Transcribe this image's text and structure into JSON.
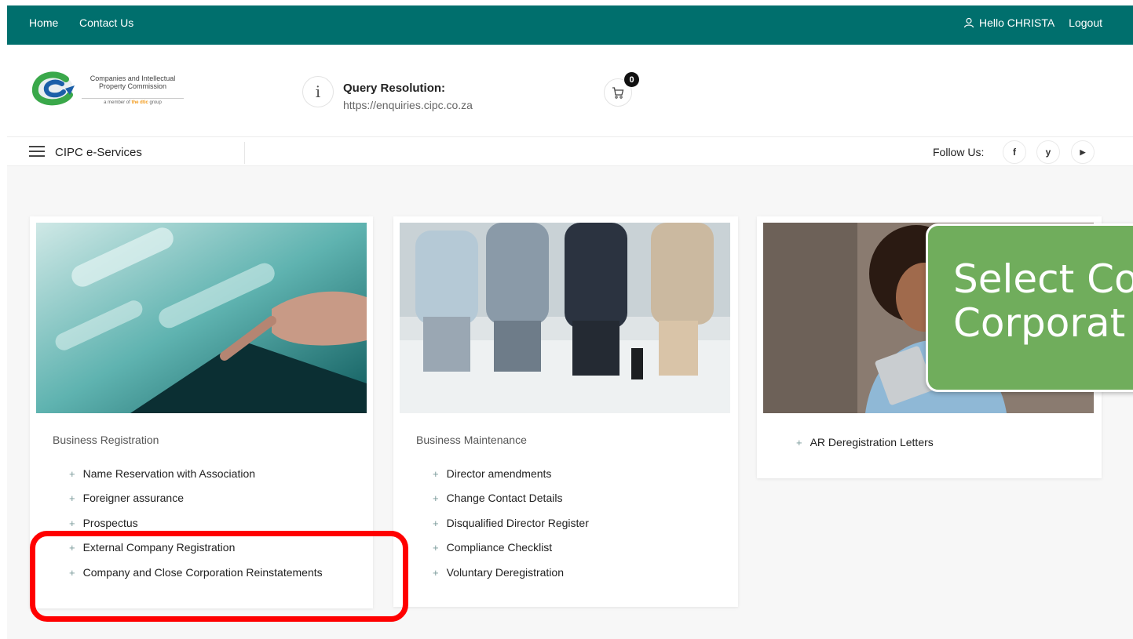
{
  "topbar": {
    "nav": [
      "Home",
      "Contact Us"
    ],
    "greeting": "Hello CHRISTA",
    "logout": "Logout"
  },
  "header": {
    "logo_line1": "Companies and Intellectual",
    "logo_line2": "Property Commission",
    "logo_sub_pre": "a member of",
    "logo_sub_brand": "the dtic",
    "logo_sub_post": "group",
    "query_title": "Query Resolution:",
    "query_url": "https://enquiries.cipc.co.za",
    "cart_count": "0"
  },
  "navbar": {
    "title": "CIPC e-Services",
    "follow_label": "Follow Us:",
    "social": [
      {
        "icon": "facebook-icon",
        "glyph": "f"
      },
      {
        "icon": "twitter-icon",
        "glyph": "y"
      },
      {
        "icon": "youtube-icon",
        "glyph": "▶"
      }
    ]
  },
  "cards": [
    {
      "title": "Business Registration",
      "items": [
        "Name Reservation with Association",
        "Foreigner assurance",
        "Prospectus",
        "External Company Registration",
        "Company and Close Corporation Reinstatements"
      ]
    },
    {
      "title": "Business Maintenance",
      "items": [
        "Director amendments",
        "Change Contact Details",
        "Disqualified Director Register",
        "Compliance Checklist",
        "Voluntary Deregistration"
      ]
    },
    {
      "title": "",
      "items": [
        "AR Deregistration Letters"
      ]
    }
  ],
  "callout": {
    "line1": "Select Co",
    "line2": "Corporat"
  },
  "colors": {
    "topbar": "#006f6d",
    "callout": "#70ad5c",
    "highlight": "#ff0000"
  }
}
